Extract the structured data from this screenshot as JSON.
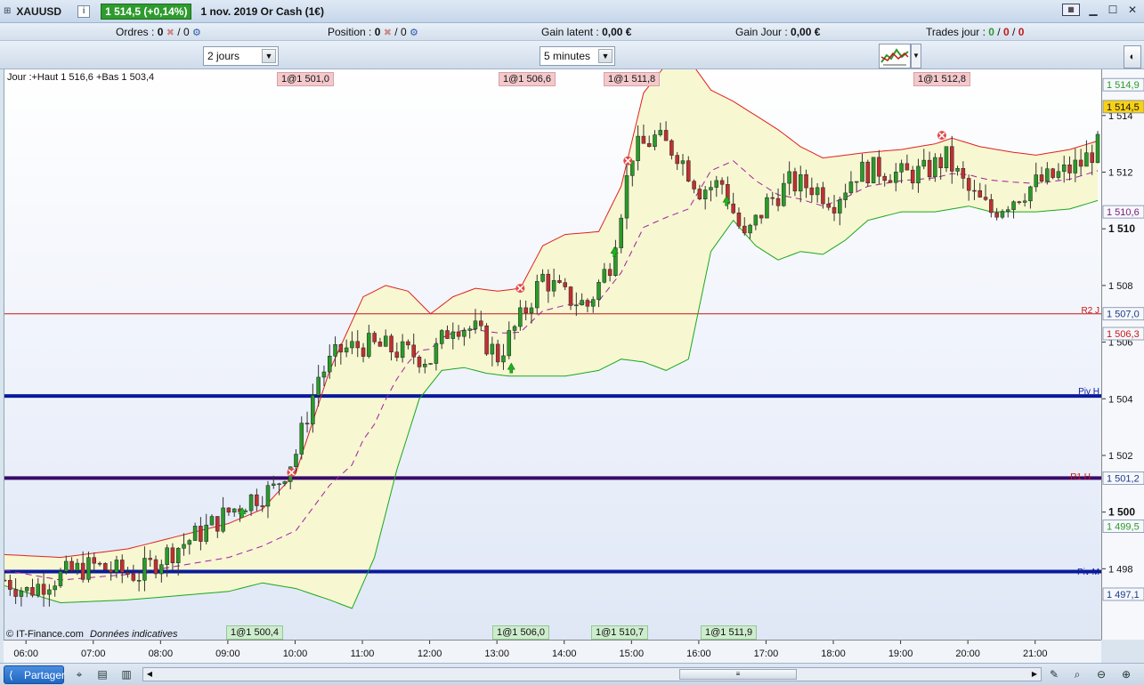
{
  "title_bar": {
    "symbol": "XAUUSD",
    "info_icon": "info-icon",
    "price_badge": "1 514,5 (+0,14%)",
    "description": "1 nov. 2019 Or Cash (1€)"
  },
  "stats": {
    "orders_label": "Ordres :",
    "orders_value_1": "0",
    "orders_value_2": "/ 0",
    "position_label": "Position :",
    "position_value_1": "0",
    "position_value_2": "/ 0",
    "gain_latent_label": "Gain latent :",
    "gain_latent_value": "0,00 €",
    "gain_jour_label": "Gain Jour :",
    "gain_jour_value": "0,00 €",
    "trades_label": "Trades jour :",
    "trades_green": "0",
    "trades_sep1": "/",
    "trades_red1": "0",
    "trades_sep2": "/",
    "trades_red2": "0"
  },
  "controls": {
    "period_select": "2 jours",
    "interval_select": "5 minutes"
  },
  "chart_header": {
    "day_info": "Jour :+Haut 1 516,6 +Bas 1 503,4"
  },
  "trade_tags_top": [
    {
      "text": "1@1 501,0"
    },
    {
      "text": "1@1 506,6"
    },
    {
      "text": "1@1 511,8"
    },
    {
      "text": "1@1 512,8"
    }
  ],
  "trade_tags_bottom": [
    {
      "text": "1@1 500,4"
    },
    {
      "text": "1@1 506,0"
    },
    {
      "text": "1@1 510,7"
    },
    {
      "text": "1@1 511,9"
    }
  ],
  "level_labels": {
    "r2": "R2 J",
    "pivh": "Piv H",
    "r1": "R1 H",
    "pivm": "Piv M"
  },
  "footer": {
    "copyright": "© IT-Finance.com",
    "disclaimer": "Données indicatives"
  },
  "y_axis": {
    "ticks": [
      "1 514",
      "1 512",
      "1 510",
      "1 508",
      "1 506",
      "1 504",
      "1 502",
      "1 500",
      "1 498"
    ],
    "tags": [
      {
        "text": "1 514,9",
        "color": "#2a9a2a"
      },
      {
        "text": "1 514,5",
        "color": "#111111",
        "bg": "#f7d117"
      },
      {
        "text": "1 510,6",
        "color": "#7a1a7a"
      },
      {
        "text": "1 507,0",
        "color": "#1a3a8a"
      },
      {
        "text": "1 506,3",
        "color": "#c41818"
      },
      {
        "text": "1 501,2",
        "color": "#1a3a8a"
      },
      {
        "text": "1 499,5",
        "color": "#2a9a2a"
      },
      {
        "text": "1 497,1",
        "color": "#1a3a8a"
      }
    ]
  },
  "x_axis": {
    "ticks": [
      "06:00",
      "07:00",
      "08:00",
      "09:00",
      "10:00",
      "11:00",
      "12:00",
      "13:00",
      "14:00",
      "15:00",
      "16:00",
      "17:00",
      "18:00",
      "19:00",
      "20:00",
      "21:00"
    ]
  },
  "bottom_bar": {
    "share_label": "Partager"
  },
  "colors": {
    "bull": "#2a9a2a",
    "bear": "#c03030",
    "band_upper": "#e02020",
    "band_lower": "#1aa81a",
    "band_fill": "#f7f7d2",
    "middle": "#a020a0",
    "piv_h": "#0a1a9a",
    "r1": "#3a0a6a",
    "piv_m": "#0a1a9a",
    "r2": "#c41818"
  },
  "chart_data": {
    "type": "candlestick",
    "symbol": "XAUUSD",
    "interval": "5 minutes",
    "y_range": [
      1496.0,
      1515.0
    ],
    "x_range": [
      "05:40",
      "21:55"
    ],
    "grid": false,
    "levels": [
      {
        "name": "R2 J",
        "value": 1507.0
      },
      {
        "name": "Piv H",
        "value": 1504.1
      },
      {
        "name": "R1 H",
        "value": 1501.2
      },
      {
        "name": "Piv M",
        "value": 1497.9
      }
    ],
    "price_path": [
      [
        "05:40",
        1497.6
      ],
      [
        "06:00",
        1497.2
      ],
      [
        "06:20",
        1497.6
      ],
      [
        "06:40",
        1497.9
      ],
      [
        "07:00",
        1498.1
      ],
      [
        "07:20",
        1497.9
      ],
      [
        "07:40",
        1497.8
      ],
      [
        "08:00",
        1498.4
      ],
      [
        "08:20",
        1498.9
      ],
      [
        "08:40",
        1499.4
      ],
      [
        "09:00",
        1500.0
      ],
      [
        "09:20",
        1500.5
      ],
      [
        "09:40",
        1500.8
      ],
      [
        "10:00",
        1502.1
      ],
      [
        "10:20",
        1504.8
      ],
      [
        "10:40",
        1505.7
      ],
      [
        "11:00",
        1505.9
      ],
      [
        "11:20",
        1505.8
      ],
      [
        "11:40",
        1505.6
      ],
      [
        "12:00",
        1505.4
      ],
      [
        "12:20",
        1506.7
      ],
      [
        "12:40",
        1506.4
      ],
      [
        "13:00",
        1505.5
      ],
      [
        "13:20",
        1506.8
      ],
      [
        "13:40",
        1508.3
      ],
      [
        "14:00",
        1507.6
      ],
      [
        "14:20",
        1507.3
      ],
      [
        "14:40",
        1508.8
      ],
      [
        "15:00",
        1512.7
      ],
      [
        "15:20",
        1513.2
      ],
      [
        "15:40",
        1512.7
      ],
      [
        "16:00",
        1511.4
      ],
      [
        "16:20",
        1511.6
      ],
      [
        "16:40",
        1509.6
      ],
      [
        "17:00",
        1510.9
      ],
      [
        "17:20",
        1511.6
      ],
      [
        "17:40",
        1511.5
      ],
      [
        "18:00",
        1511.0
      ],
      [
        "18:20",
        1512.0
      ],
      [
        "18:40",
        1512.1
      ],
      [
        "19:00",
        1511.9
      ],
      [
        "19:20",
        1512.0
      ],
      [
        "19:40",
        1512.5
      ],
      [
        "20:00",
        1511.3
      ],
      [
        "20:20",
        1510.6
      ],
      [
        "20:40",
        1511.1
      ],
      [
        "21:00",
        1511.6
      ],
      [
        "21:20",
        1511.9
      ],
      [
        "21:40",
        1512.3
      ],
      [
        "21:55",
        1512.9
      ]
    ],
    "bollinger": {
      "upper": [
        [
          "05:40",
          1498.5
        ],
        [
          "06:30",
          1498.4
        ],
        [
          "07:30",
          1498.7
        ],
        [
          "08:30",
          1499.3
        ],
        [
          "09:00",
          1499.6
        ],
        [
          "09:30",
          1500.1
        ],
        [
          "10:00",
          1501.4
        ],
        [
          "10:30",
          1505.0
        ],
        [
          "11:00",
          1507.6
        ],
        [
          "11:20",
          1508.0
        ],
        [
          "11:40",
          1507.8
        ],
        [
          "12:00",
          1507.0
        ],
        [
          "12:20",
          1507.6
        ],
        [
          "12:40",
          1507.9
        ],
        [
          "13:00",
          1507.8
        ],
        [
          "13:20",
          1507.9
        ],
        [
          "13:40",
          1509.4
        ],
        [
          "14:00",
          1509.8
        ],
        [
          "14:30",
          1509.9
        ],
        [
          "14:50",
          1511.5
        ],
        [
          "15:10",
          1514.8
        ],
        [
          "15:30",
          1515.8
        ],
        [
          "15:50",
          1516.0
        ],
        [
          "16:10",
          1514.9
        ],
        [
          "16:30",
          1514.5
        ],
        [
          "16:50",
          1514.0
        ],
        [
          "17:10",
          1513.5
        ],
        [
          "17:30",
          1512.9
        ],
        [
          "17:50",
          1512.5
        ],
        [
          "18:30",
          1512.7
        ],
        [
          "19:00",
          1512.8
        ],
        [
          "19:30",
          1513.0
        ],
        [
          "19:45",
          1513.2
        ],
        [
          "20:10",
          1512.9
        ],
        [
          "20:40",
          1512.7
        ],
        [
          "21:00",
          1512.6
        ],
        [
          "21:30",
          1512.8
        ],
        [
          "21:55",
          1513.1
        ]
      ],
      "lower": [
        [
          "05:40",
          1497.4
        ],
        [
          "06:30",
          1496.8
        ],
        [
          "07:30",
          1496.9
        ],
        [
          "08:30",
          1497.1
        ],
        [
          "09:00",
          1497.2
        ],
        [
          "09:30",
          1497.5
        ],
        [
          "10:00",
          1497.3
        ],
        [
          "10:30",
          1496.9
        ],
        [
          "10:50",
          1496.6
        ],
        [
          "11:10",
          1498.4
        ],
        [
          "11:30",
          1501.5
        ],
        [
          "11:50",
          1504.0
        ],
        [
          "12:10",
          1505.0
        ],
        [
          "12:30",
          1505.1
        ],
        [
          "12:50",
          1504.9
        ],
        [
          "13:10",
          1504.8
        ],
        [
          "13:30",
          1504.8
        ],
        [
          "14:00",
          1504.8
        ],
        [
          "14:30",
          1505.0
        ],
        [
          "14:50",
          1505.4
        ],
        [
          "15:10",
          1505.3
        ],
        [
          "15:30",
          1505.0
        ],
        [
          "15:50",
          1505.4
        ],
        [
          "16:10",
          1509.2
        ],
        [
          "16:30",
          1510.3
        ],
        [
          "16:50",
          1509.4
        ],
        [
          "17:10",
          1508.9
        ],
        [
          "17:30",
          1509.2
        ],
        [
          "17:50",
          1509.1
        ],
        [
          "18:10",
          1509.6
        ],
        [
          "18:30",
          1510.3
        ],
        [
          "19:00",
          1510.6
        ],
        [
          "19:30",
          1510.6
        ],
        [
          "20:00",
          1510.8
        ],
        [
          "20:20",
          1510.6
        ],
        [
          "20:40",
          1510.6
        ],
        [
          "21:00",
          1510.6
        ],
        [
          "21:30",
          1510.7
        ],
        [
          "21:55",
          1511.0
        ]
      ]
    },
    "entry_markers": [
      [
        "09:12",
        1500.0
      ],
      [
        "13:12",
        1505.1
      ],
      [
        "14:44",
        1509.2
      ],
      [
        "16:24",
        1511.0
      ]
    ],
    "exit_markers": [
      [
        "09:56",
        1501.4
      ],
      [
        "13:20",
        1507.9
      ],
      [
        "14:56",
        1512.4
      ],
      [
        "19:36",
        1513.3
      ]
    ],
    "annotations_top": [
      "1@1 501,0",
      "1@1 506,6",
      "1@1 511,8",
      "1@1 512,8"
    ],
    "annotations_bottom": [
      "1@1 500,4",
      "1@1 506,0",
      "1@1 510,7",
      "1@1 511,9"
    ]
  }
}
